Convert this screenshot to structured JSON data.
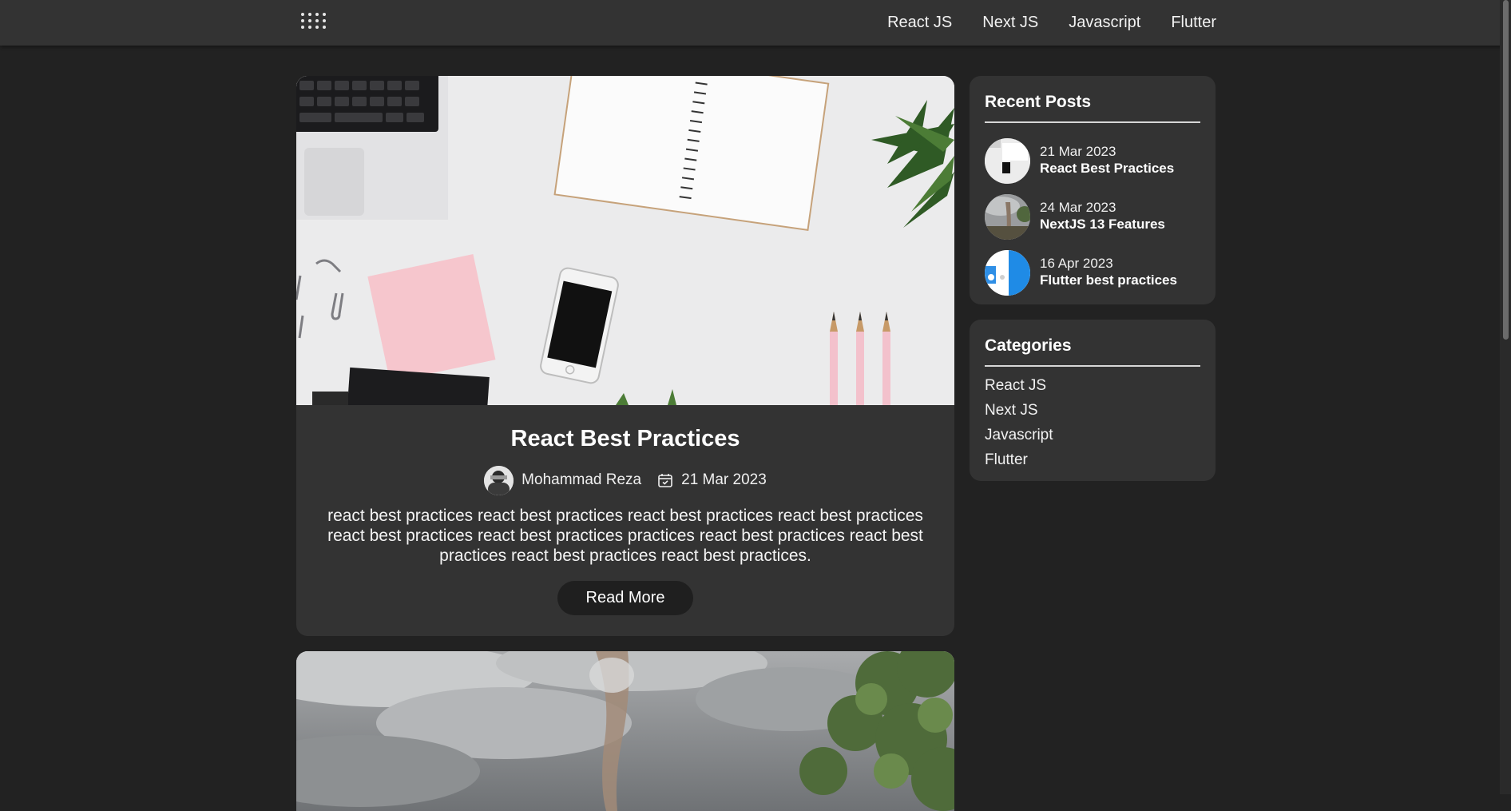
{
  "nav": {
    "logo_icon": "grid-dots-icon",
    "links": [
      {
        "label": "React JS"
      },
      {
        "label": "Next JS"
      },
      {
        "label": "Javascript"
      },
      {
        "label": "Flutter"
      }
    ]
  },
  "post": {
    "image": "desk-flatlay-image",
    "title": "React Best Practices",
    "author": "Mohammad Reza",
    "date": "21 Mar 2023",
    "excerpt": "react best practices react best practices react best practices react best practices react best practices react best practices practices react best practices react best practices react best practices react best practices.",
    "read_more_label": "Read More"
  },
  "second_post": {
    "image": "tornado-image"
  },
  "sidebar": {
    "recent_posts": {
      "title": "Recent Posts",
      "items": [
        {
          "date": "21 Mar 2023",
          "title": "React Best Practices"
        },
        {
          "date": "24 Mar 2023",
          "title": "NextJS 13 Features"
        },
        {
          "date": "16 Apr 2023",
          "title": "Flutter best practices"
        }
      ]
    },
    "categories": {
      "title": "Categories",
      "items": [
        {
          "label": "React JS"
        },
        {
          "label": "Next JS"
        },
        {
          "label": "Javascript"
        },
        {
          "label": "Flutter"
        }
      ]
    }
  },
  "colors": {
    "page_background": "#222222",
    "card_background": "#333333",
    "button_background": "#1f1f1f",
    "text": "#ffffff"
  }
}
